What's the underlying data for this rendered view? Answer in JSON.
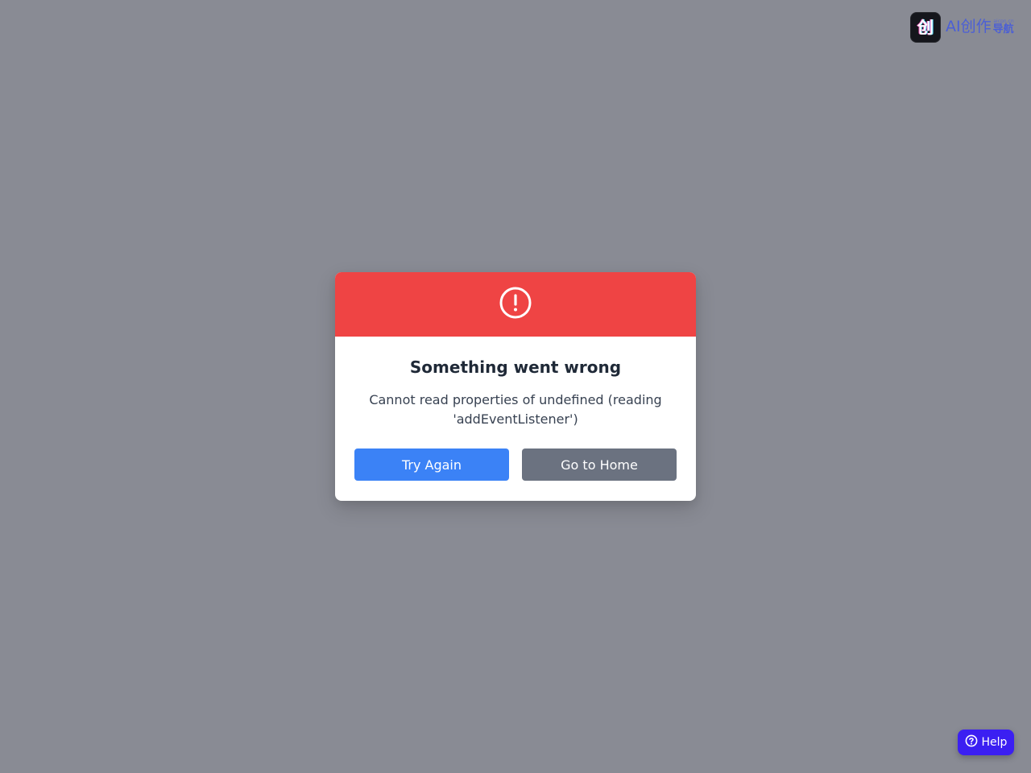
{
  "logo": {
    "mark_glyph": "创",
    "main_text": "AI创作",
    "small_text": "aicpn.cn",
    "sub_text": "导航",
    "text_color": "#4b5fd6"
  },
  "dialog": {
    "header_color": "#ef4444",
    "icon": "exclamation-circle-icon",
    "title": "Something went wrong",
    "message": "Cannot read properties of undefined (reading 'addEventListener')",
    "buttons": {
      "try_again": "Try Again",
      "go_home": "Go to Home"
    },
    "colors": {
      "primary": "#3b82f6",
      "secondary": "#6b7280"
    }
  },
  "help": {
    "label": "Help",
    "icon": "question-circle-icon",
    "color": "#3b1ff2"
  },
  "overlay_color": "#898b94"
}
